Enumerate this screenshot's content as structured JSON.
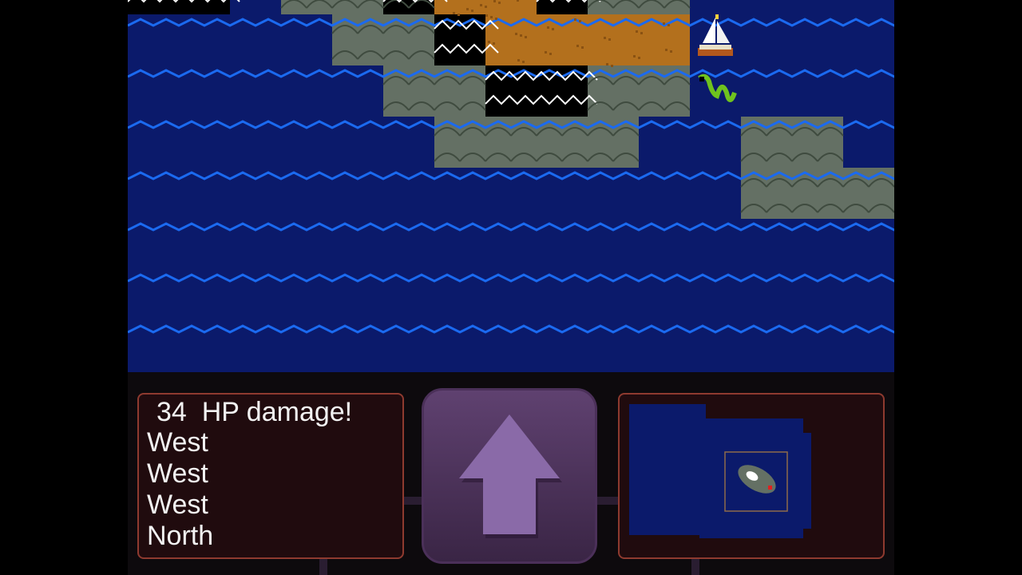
{
  "game": {
    "palette": {
      "water": "#0b1a6b",
      "wave": "#1b6af0",
      "rock": "#647064",
      "mountain": "#000000",
      "sand": "#b3701d",
      "panel_bg": "#200b0e",
      "panel_border": "#8e3a2f",
      "button": "#5f4170",
      "arrow": "#8a6aa8"
    },
    "map": {
      "terrain": [
        "water",
        "rock",
        "mountain",
        "sand"
      ],
      "player_sprite": "sailing-ship-sprite",
      "enemy_sprite": "sea-serpent-sprite"
    },
    "message_log": {
      "damage_amount": "34",
      "damage_text": "HP damage!",
      "lines": [
        "West",
        "West",
        "West",
        "North"
      ]
    },
    "controls": {
      "move_button_icon": "arrow-up-icon"
    },
    "minimap": {
      "icon": "minimap-island-icon"
    }
  }
}
